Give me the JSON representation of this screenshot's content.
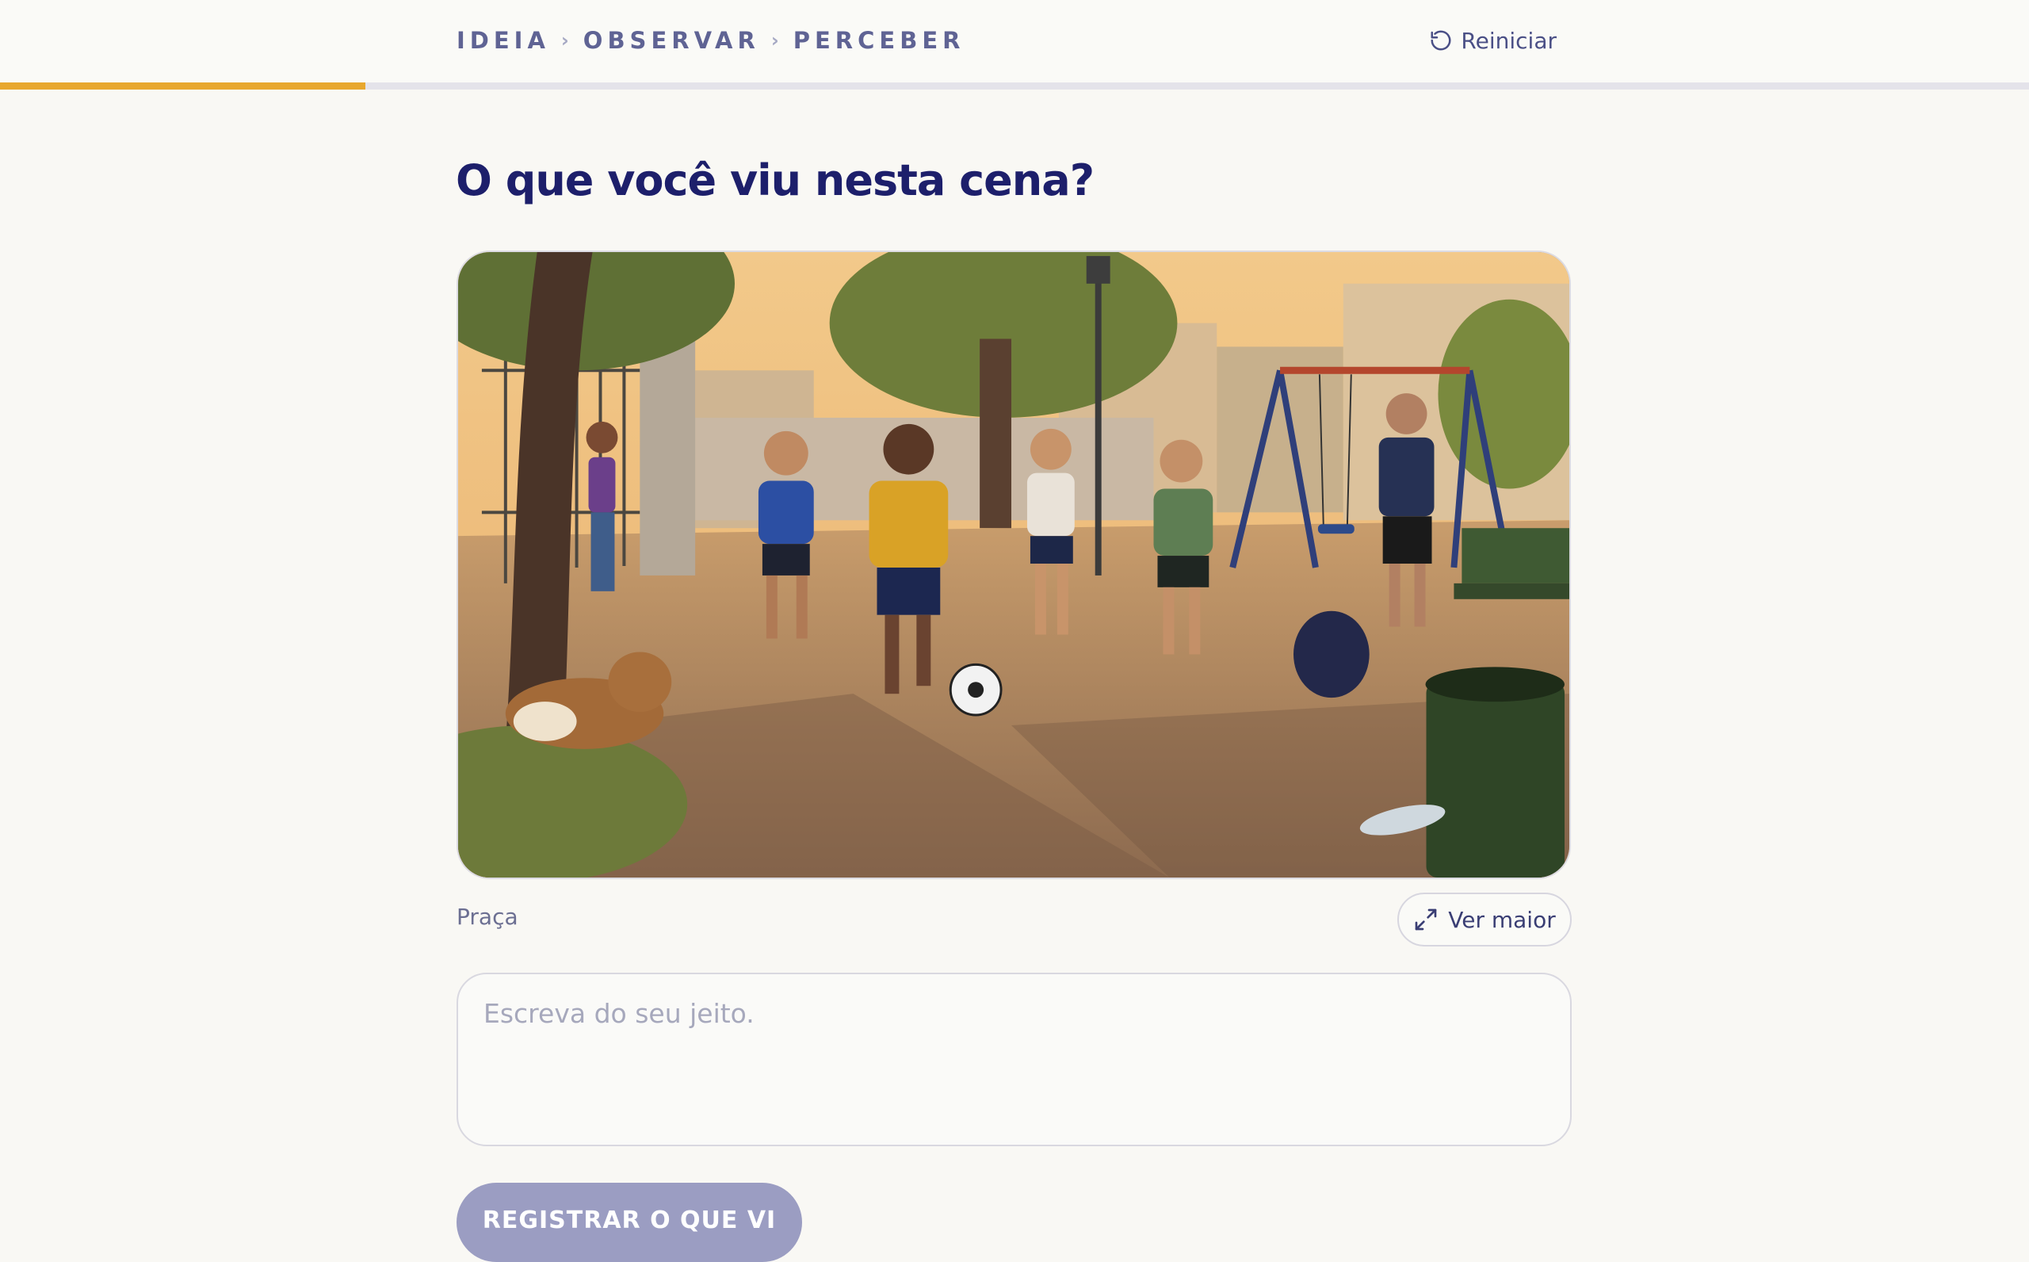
{
  "header": {
    "breadcrumb": [
      "IDEIA",
      "OBSERVAR",
      "PERCEBER"
    ],
    "breadcrumb_separator": "›",
    "reset_label": "Reiniciar",
    "reset_icon": "rotate-ccw-icon",
    "progress": 0.18,
    "progress_color": "#e8a72e"
  },
  "main": {
    "title": "O que você viu nesta cena?",
    "scene": {
      "caption": "Praça",
      "view_more_label": "Ver maior",
      "view_more_icon": "expand-icon"
    },
    "answer": {
      "placeholder": "Escreva do seu jeito.",
      "value": ""
    },
    "submit_label": "REGISTRAR O QUE VI"
  },
  "colors": {
    "title": "#1d1f6b",
    "accent": "#e8a72e",
    "submit_disabled": "#9b9dc2",
    "background": "#f9f8f4"
  }
}
